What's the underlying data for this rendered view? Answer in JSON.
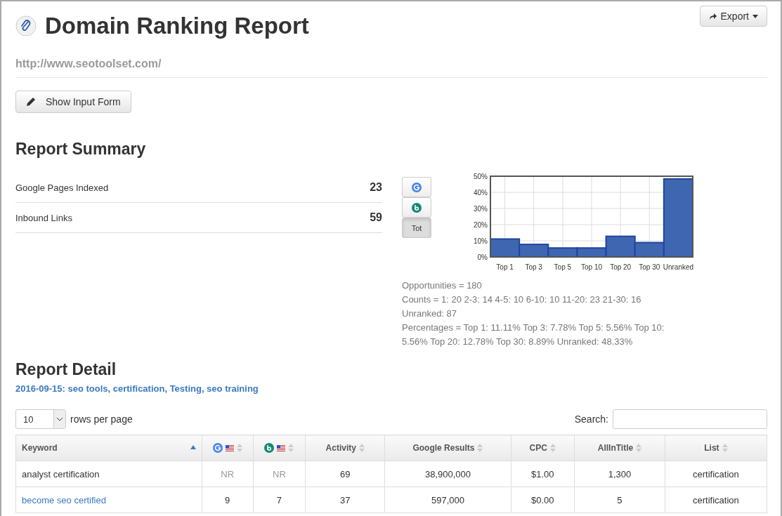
{
  "header": {
    "title": "Domain Ranking Report",
    "url": "http://www.seotoolset.com/",
    "export_button": "Export",
    "input_button": "Show Input Form"
  },
  "summary": {
    "title": "Report Summary",
    "metrics": [
      {
        "label": "Google Pages Indexed",
        "value": "23"
      },
      {
        "label": "Inbound Links",
        "value": "59"
      }
    ],
    "engine_tabs": [
      {
        "kind": "google",
        "selected": false
      },
      {
        "kind": "bing",
        "selected": false
      },
      {
        "kind": "text",
        "label": "Tot",
        "selected": true
      }
    ],
    "chart_data": {
      "type": "bar",
      "categories": [
        "Top 1",
        "Top 3",
        "Top 5",
        "Top 10",
        "Top 20",
        "Top 30",
        "Unranked"
      ],
      "grid": true,
      "series": [
        {
          "color": "#3f66b0",
          "values": [
            11.11,
            7.78,
            5.56,
            5.56,
            12.78,
            8.89,
            48.33
          ]
        }
      ],
      "ylim": [
        0,
        50
      ],
      "yticks": [
        {
          "value": 0,
          "label": "0%"
        },
        {
          "value": 10,
          "label": "10%"
        },
        {
          "value": 20,
          "label": "20%"
        },
        {
          "value": 30,
          "label": "30%"
        },
        {
          "value": 40,
          "label": "40%"
        },
        {
          "value": 50,
          "label": "50%"
        }
      ]
    },
    "stats": [
      "Opportunities = 180",
      "Counts = 1: 20 2-3: 14 4-5: 10 6-10: 10 11-20: 23 21-30: 16 Unranked: 87",
      "Percentages = Top 1: 11.11% Top 3: 7.78% Top 5: 5.56% Top 10: 5.56% Top 20: 12.78% Top 30: 8.89% Unranked: 48.33%"
    ]
  },
  "detail": {
    "title": "Report Detail",
    "subtitle": "2016-09-15: seo tools, certification, Testing, seo training",
    "page_size": "10",
    "page_size_label": "rows per page",
    "search_label": "Search:",
    "columns": [
      {
        "kind": "text",
        "label": "Keyword",
        "sorted": true
      },
      {
        "kind": "google",
        "sorted": false
      },
      {
        "kind": "bing",
        "sorted": false
      },
      {
        "kind": "text",
        "label": "Activity",
        "sorted": false
      },
      {
        "kind": "text",
        "label": "Google Results",
        "sorted": false
      },
      {
        "kind": "text",
        "label": "CPC",
        "sorted": false
      },
      {
        "kind": "text",
        "label": "AllInTitle",
        "sorted": false
      },
      {
        "kind": "text",
        "label": "List",
        "sorted": false
      }
    ],
    "rows": [
      {
        "keyword": "analyst certification",
        "link": false,
        "google": "NR",
        "google_ranked": false,
        "bing": "NR",
        "bing_ranked": false,
        "activity": "69",
        "results": "38,900,000",
        "cpc": "$1.00",
        "allintitle": "1,300",
        "list": "certification"
      },
      {
        "keyword": "become seo certified",
        "link": true,
        "google": "9",
        "google_ranked": true,
        "bing": "7",
        "bing_ranked": true,
        "activity": "37",
        "results": "597,000",
        "cpc": "$0.00",
        "allintitle": "5",
        "list": "certification"
      }
    ]
  }
}
